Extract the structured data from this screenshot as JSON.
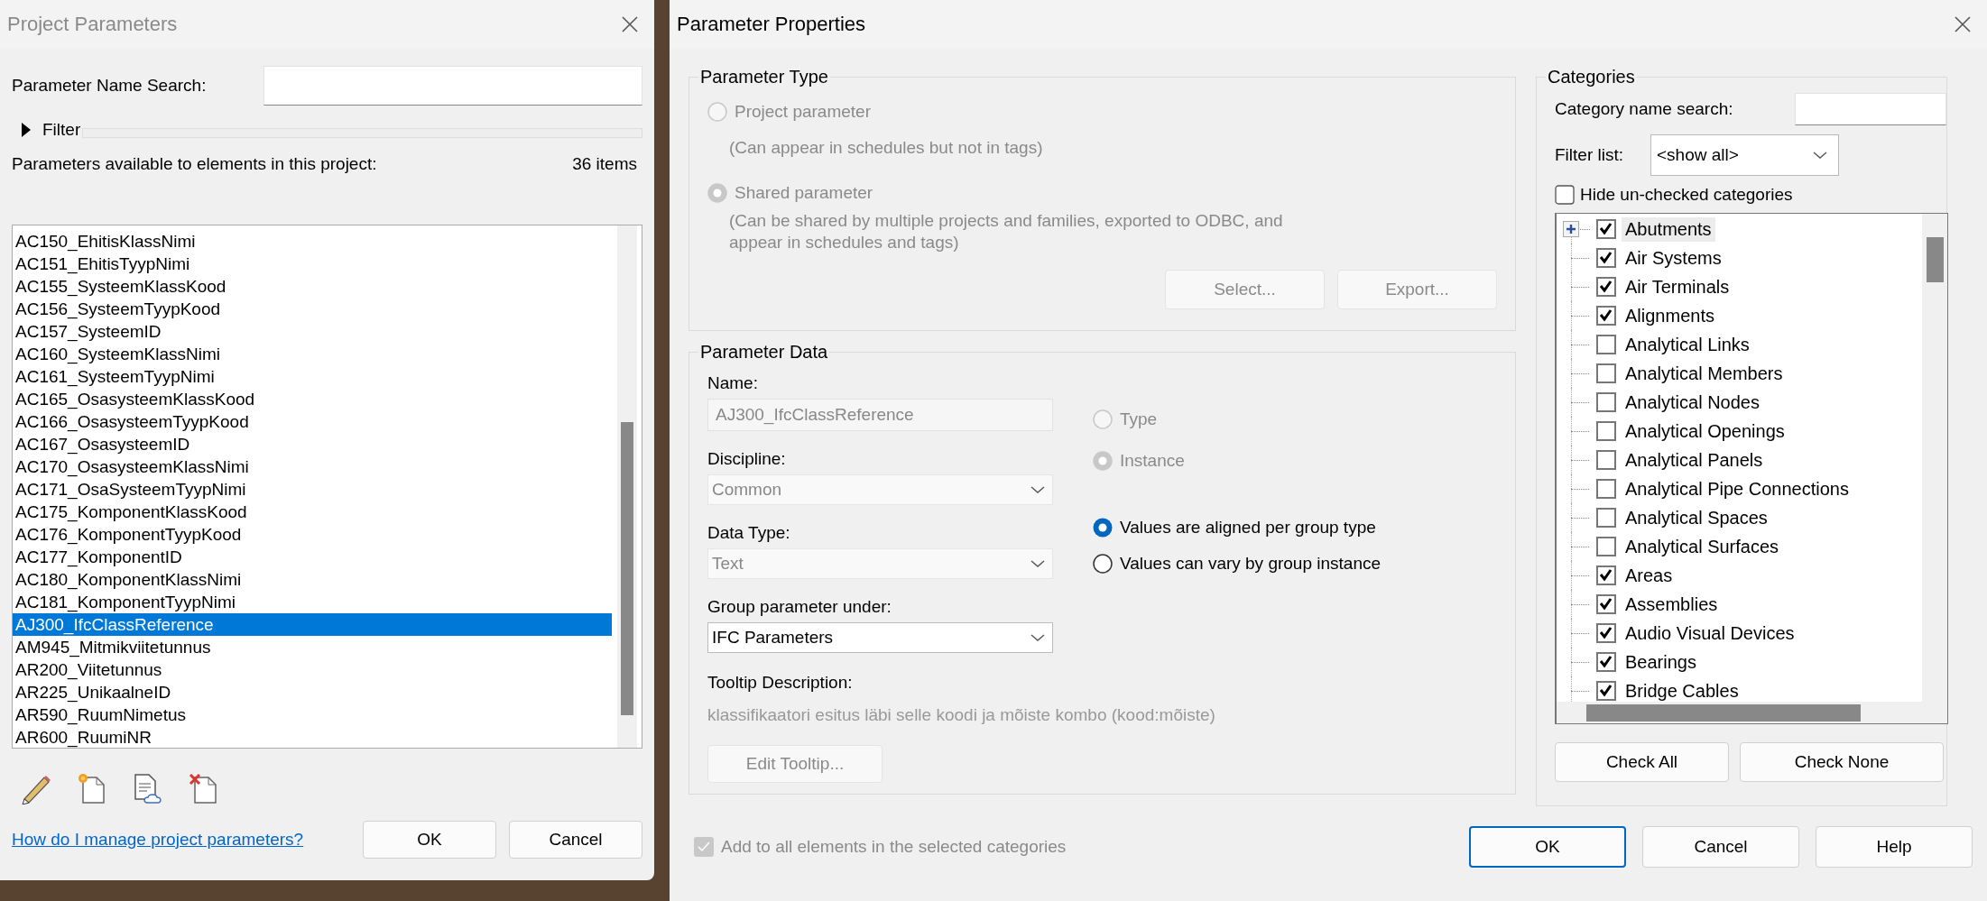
{
  "project_parameters": {
    "title": "Project Parameters",
    "search": {
      "label": "Parameter Name Search:"
    },
    "filter": {
      "label": "Filter",
      "expanded": false
    },
    "list_label": "Parameters available to elements in this project:",
    "count": "36 items",
    "items": [
      {
        "label": "AC150_EhitisKlassNimi",
        "selected": false
      },
      {
        "label": "AC151_EhitisTyypNimi",
        "selected": false
      },
      {
        "label": "AC155_SysteemKlassKood",
        "selected": false
      },
      {
        "label": "AC156_SysteemTyypKood",
        "selected": false
      },
      {
        "label": "AC157_SysteemID",
        "selected": false
      },
      {
        "label": "AC160_SysteemKlassNimi",
        "selected": false
      },
      {
        "label": "AC161_SysteemTyypNimi",
        "selected": false
      },
      {
        "label": "AC165_OsasysteemKlassKood",
        "selected": false
      },
      {
        "label": "AC166_OsasysteemTyypKood",
        "selected": false
      },
      {
        "label": "AC167_OsasysteemID",
        "selected": false
      },
      {
        "label": "AC170_OsasysteemKlassNimi",
        "selected": false
      },
      {
        "label": "AC171_OsaSysteemTyypNimi",
        "selected": false
      },
      {
        "label": "AC175_KomponentKlassKood",
        "selected": false
      },
      {
        "label": "AC176_KomponentTyypKood",
        "selected": false
      },
      {
        "label": "AC177_KomponentID",
        "selected": false
      },
      {
        "label": "AC180_KomponentKlassNimi",
        "selected": false
      },
      {
        "label": "AC181_KomponentTyypNimi",
        "selected": false
      },
      {
        "label": "AJ300_IfcClassReference",
        "selected": true
      },
      {
        "label": "AM945_Mitmikviitetunnus",
        "selected": false
      },
      {
        "label": "AR200_Viitetunnus",
        "selected": false
      },
      {
        "label": "AR225_UnikaalneID",
        "selected": false
      },
      {
        "label": "AR590_RuumNimetus",
        "selected": false
      },
      {
        "label": "AR600_RuumiNR",
        "selected": false
      }
    ],
    "help_link": "How do I manage project parameters?",
    "buttons": [
      "OK",
      "Cancel"
    ]
  },
  "parameter_properties": {
    "title": "Parameter Properties",
    "parameter_type": {
      "title": "Parameter Type",
      "options": [
        {
          "label": "Project parameter",
          "note": "(Can appear in schedules but not in tags)",
          "selected": false,
          "disabled": true
        },
        {
          "label": "Shared parameter",
          "note": "(Can be shared by multiple projects and families, exported to ODBC, and appear in schedules and tags)",
          "selected": true,
          "disabled": true
        }
      ],
      "buttons": [
        {
          "label": "Select...",
          "disabled": true
        },
        {
          "label": "Export...",
          "disabled": true
        }
      ]
    },
    "parameter_data": {
      "title": "Parameter Data",
      "name": {
        "label": "Name:",
        "value": "AJ300_IfcClassReference",
        "disabled": true
      },
      "discipline": {
        "label": "Discipline:",
        "value": "Common",
        "disabled": true
      },
      "data_type": {
        "label": "Data Type:",
        "value": "Text",
        "disabled": true
      },
      "group": {
        "label": "Group parameter under:",
        "value": "IFC Parameters",
        "disabled": false
      },
      "scope": [
        {
          "label": "Type",
          "selected": false,
          "disabled": true
        },
        {
          "label": "Instance",
          "selected": true,
          "disabled": true
        }
      ],
      "group_values": [
        {
          "label": "Values are aligned per group type",
          "selected": true,
          "disabled": false
        },
        {
          "label": "Values can vary by group instance",
          "selected": false,
          "disabled": false
        }
      ],
      "tooltip": {
        "label": "Tooltip Description:",
        "text": "klassifikaatori esitus läbi selle koodi ja mõiste kombo (kood:mõiste)",
        "button": {
          "label": "Edit Tooltip...",
          "disabled": true
        }
      }
    },
    "categories": {
      "title": "Categories",
      "search": {
        "label": "Category name search:"
      },
      "filter": {
        "label": "Filter list:",
        "value": "<show all>"
      },
      "hide_unchecked": {
        "label": "Hide un-checked categories",
        "checked": false
      },
      "items": [
        {
          "label": "Abutments",
          "kind": "group",
          "expanded": false,
          "checked": true,
          "selected": true
        },
        {
          "label": "Air Systems",
          "kind": "leaf",
          "checked": true,
          "selected": false
        },
        {
          "label": "Air Terminals",
          "kind": "leaf",
          "checked": true,
          "selected": false
        },
        {
          "label": "Alignments",
          "kind": "leaf",
          "checked": true,
          "selected": false
        },
        {
          "label": "Analytical Links",
          "kind": "leaf",
          "checked": false,
          "selected": false
        },
        {
          "label": "Analytical Members",
          "kind": "leaf",
          "checked": false,
          "selected": false
        },
        {
          "label": "Analytical Nodes",
          "kind": "leaf",
          "checked": false,
          "selected": false
        },
        {
          "label": "Analytical Openings",
          "kind": "leaf",
          "checked": false,
          "selected": false
        },
        {
          "label": "Analytical Panels",
          "kind": "leaf",
          "checked": false,
          "selected": false
        },
        {
          "label": "Analytical Pipe Connections",
          "kind": "leaf",
          "checked": false,
          "selected": false
        },
        {
          "label": "Analytical Spaces",
          "kind": "leaf",
          "checked": false,
          "selected": false
        },
        {
          "label": "Analytical Surfaces",
          "kind": "leaf",
          "checked": false,
          "selected": false
        },
        {
          "label": "Areas",
          "kind": "leaf",
          "checked": true,
          "selected": false
        },
        {
          "label": "Assemblies",
          "kind": "leaf",
          "checked": true,
          "selected": false
        },
        {
          "label": "Audio Visual Devices",
          "kind": "leaf",
          "checked": true,
          "selected": false
        },
        {
          "label": "Bearings",
          "kind": "leaf",
          "checked": true,
          "selected": false
        },
        {
          "label": "Bridge Cables",
          "kind": "leaf",
          "checked": true,
          "selected": false
        }
      ],
      "buttons": [
        "Check All",
        "Check None"
      ]
    },
    "add_to_all": {
      "label": "Add to all elements in the selected categories",
      "checked": true,
      "disabled": true
    },
    "buttons": [
      {
        "label": "OK",
        "default": true
      },
      {
        "label": "Cancel",
        "default": false
      },
      {
        "label": "Help",
        "default": false
      }
    ]
  }
}
